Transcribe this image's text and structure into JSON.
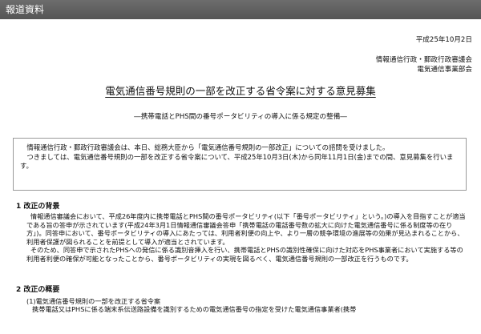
{
  "header": {
    "label": "報道資料"
  },
  "date": "平成25年10月2日",
  "issuers": [
    "情報通信行政・郵政行政審議会",
    "電気通信事業部会"
  ],
  "title": "電気通信番号規則の一部を改正する省令案に対する意見募集",
  "subtitle": "―携帯電話とPHS間の番号ポータビリティの導入に係る規定の整備―",
  "summary": {
    "paragraph1": "情報通信行政・郵政行政審議会は、本日、総務大臣から「電気通信番号規則の一部改正」についての諮問を受けました。",
    "paragraph2": "つきましては、電気通信番号規則の一部を改正する省令案について、平成25年10月3日(木)から同年11月1日(金)までの間、意見募集を行います。"
  },
  "section1": {
    "heading": "1  改正の背景",
    "paragraph1": "情報通信審議会において、平成26年度内に携帯電話とPHS間の番号ポータビリティ(以下「番号ポータビリティ」という。)の導入を目指すことが適当である旨の答申が示されています(平成24年3月1日情報通信審議会答申「携帯電話の電話番号数の拡大に向けた電気通信番号に係る制度等の在り方」)。同答申において、番号ポータビリティの導入にあたっては、利用者利便の向上や、より一層の競争環境の進展等の効果が見込まれることから、利用者保護が図られることを前提として導入が適当とされています。",
    "paragraph2": "そのため、同答申で示されたPHSへの発信に係る識別音挿入を行い、携帯電話とPHSの識別性確保に向けた対応をPHS事業者において実施する等の利用者利便の確保が可能となったことから、番号ポータビリティの実現を図るべく、電気通信番号規則の一部改正を行うものです。"
  },
  "section2": {
    "heading": "2  改正の概要",
    "item1": "(1)電気通信番号規則の一部を改正する省令案",
    "item1_text": "携帯電話又はPHSに係る端末系伝送路設備を識別するための電気通信番号の指定を受けた電気通信事業者(携帯"
  }
}
